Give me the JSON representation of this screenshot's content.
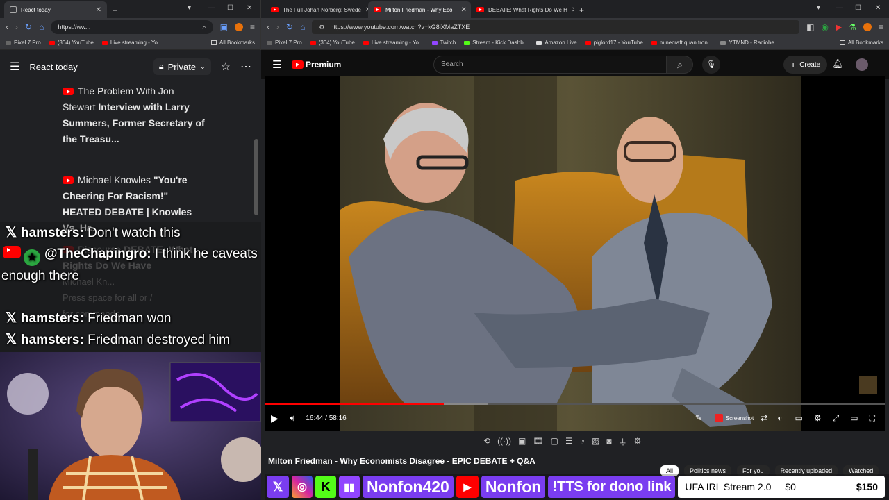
{
  "left_browser": {
    "tab_title": "React today",
    "url": "https://ww...",
    "bookmarks": [
      "Pixel 7 Pro",
      "(304) YouTube",
      "Live streaming - Yo...",
      "All Bookmarks"
    ],
    "panel_title": "React today",
    "privacy": "Private",
    "items": [
      {
        "channel": "The Problem With Jon Stewart",
        "title": "Interview with Larry Summers, Former Secretary of the Treasu..."
      },
      {
        "channel": "Michael Knowles",
        "title": "\"You're Cheering For Racism!\" HEATED DEBATE | Knowles Vs. Ha..."
      },
      {
        "channel": "Discourse",
        "title": "DEBATE: What Rights Do We Have"
      }
    ],
    "faded": [
      "Michael Kn...",
      "Press space for all or /",
      "for commands"
    ]
  },
  "chat": [
    {
      "platform": "x",
      "user": "hamsters:",
      "msg": "Don't watch this"
    },
    {
      "platform": "youtube",
      "user": "@TheChapingro:",
      "msg": "I think he caveats enough there"
    },
    {
      "platform": "x",
      "user": "hamsters:",
      "msg": "Friedman won"
    },
    {
      "platform": "x",
      "user": "hamsters:",
      "msg": "Friedman destroyed him"
    }
  ],
  "right_browser": {
    "tabs": [
      {
        "title": "The Full Johan Norberg: Swede",
        "active": false
      },
      {
        "title": "Milton Friedman - Why Eco",
        "active": true
      },
      {
        "title": "DEBATE: What Rights Do We H",
        "active": false
      }
    ],
    "url": "https://www.youtube.com/watch?v=kG8iXMaZTXE",
    "bookmarks": [
      "Pixel 7 Pro",
      "(304) YouTube",
      "Live streaming - Yo...",
      "Twitch",
      "Stream - Kick Dashb...",
      "Amazon Live",
      "piglord17 - YouTube",
      "minecraft quan tron...",
      "YTMND - Radiohe...",
      "All Bookmarks"
    ]
  },
  "youtube": {
    "logo": "Premium",
    "search_placeholder": "Search",
    "create_label": "Create",
    "time": "16:44 / 58:16",
    "progress": 0.288,
    "buffered": 0.36,
    "screenshot_label": "Screenshot",
    "video_title": "Milton Friedman - Why Economists Disagree - EPIC DEBATE + Q&A",
    "chips": [
      "All",
      "Politics news",
      "For you",
      "Recently uploaded",
      "Watched"
    ]
  },
  "overlay": {
    "kick_name": "Nonfon420",
    "yt_name": "Nonfon",
    "tts": "!TTS for dono link",
    "goal_title": "UFA IRL Stream 2.0",
    "goal_current": "$0",
    "goal_target": "$150"
  },
  "colors": {
    "yt_red": "#ff0000",
    "twitch": "#9146ff",
    "kick": "#53fc18",
    "overlay_purple": "#7a3df0",
    "goal_bg": "#ffffff"
  }
}
